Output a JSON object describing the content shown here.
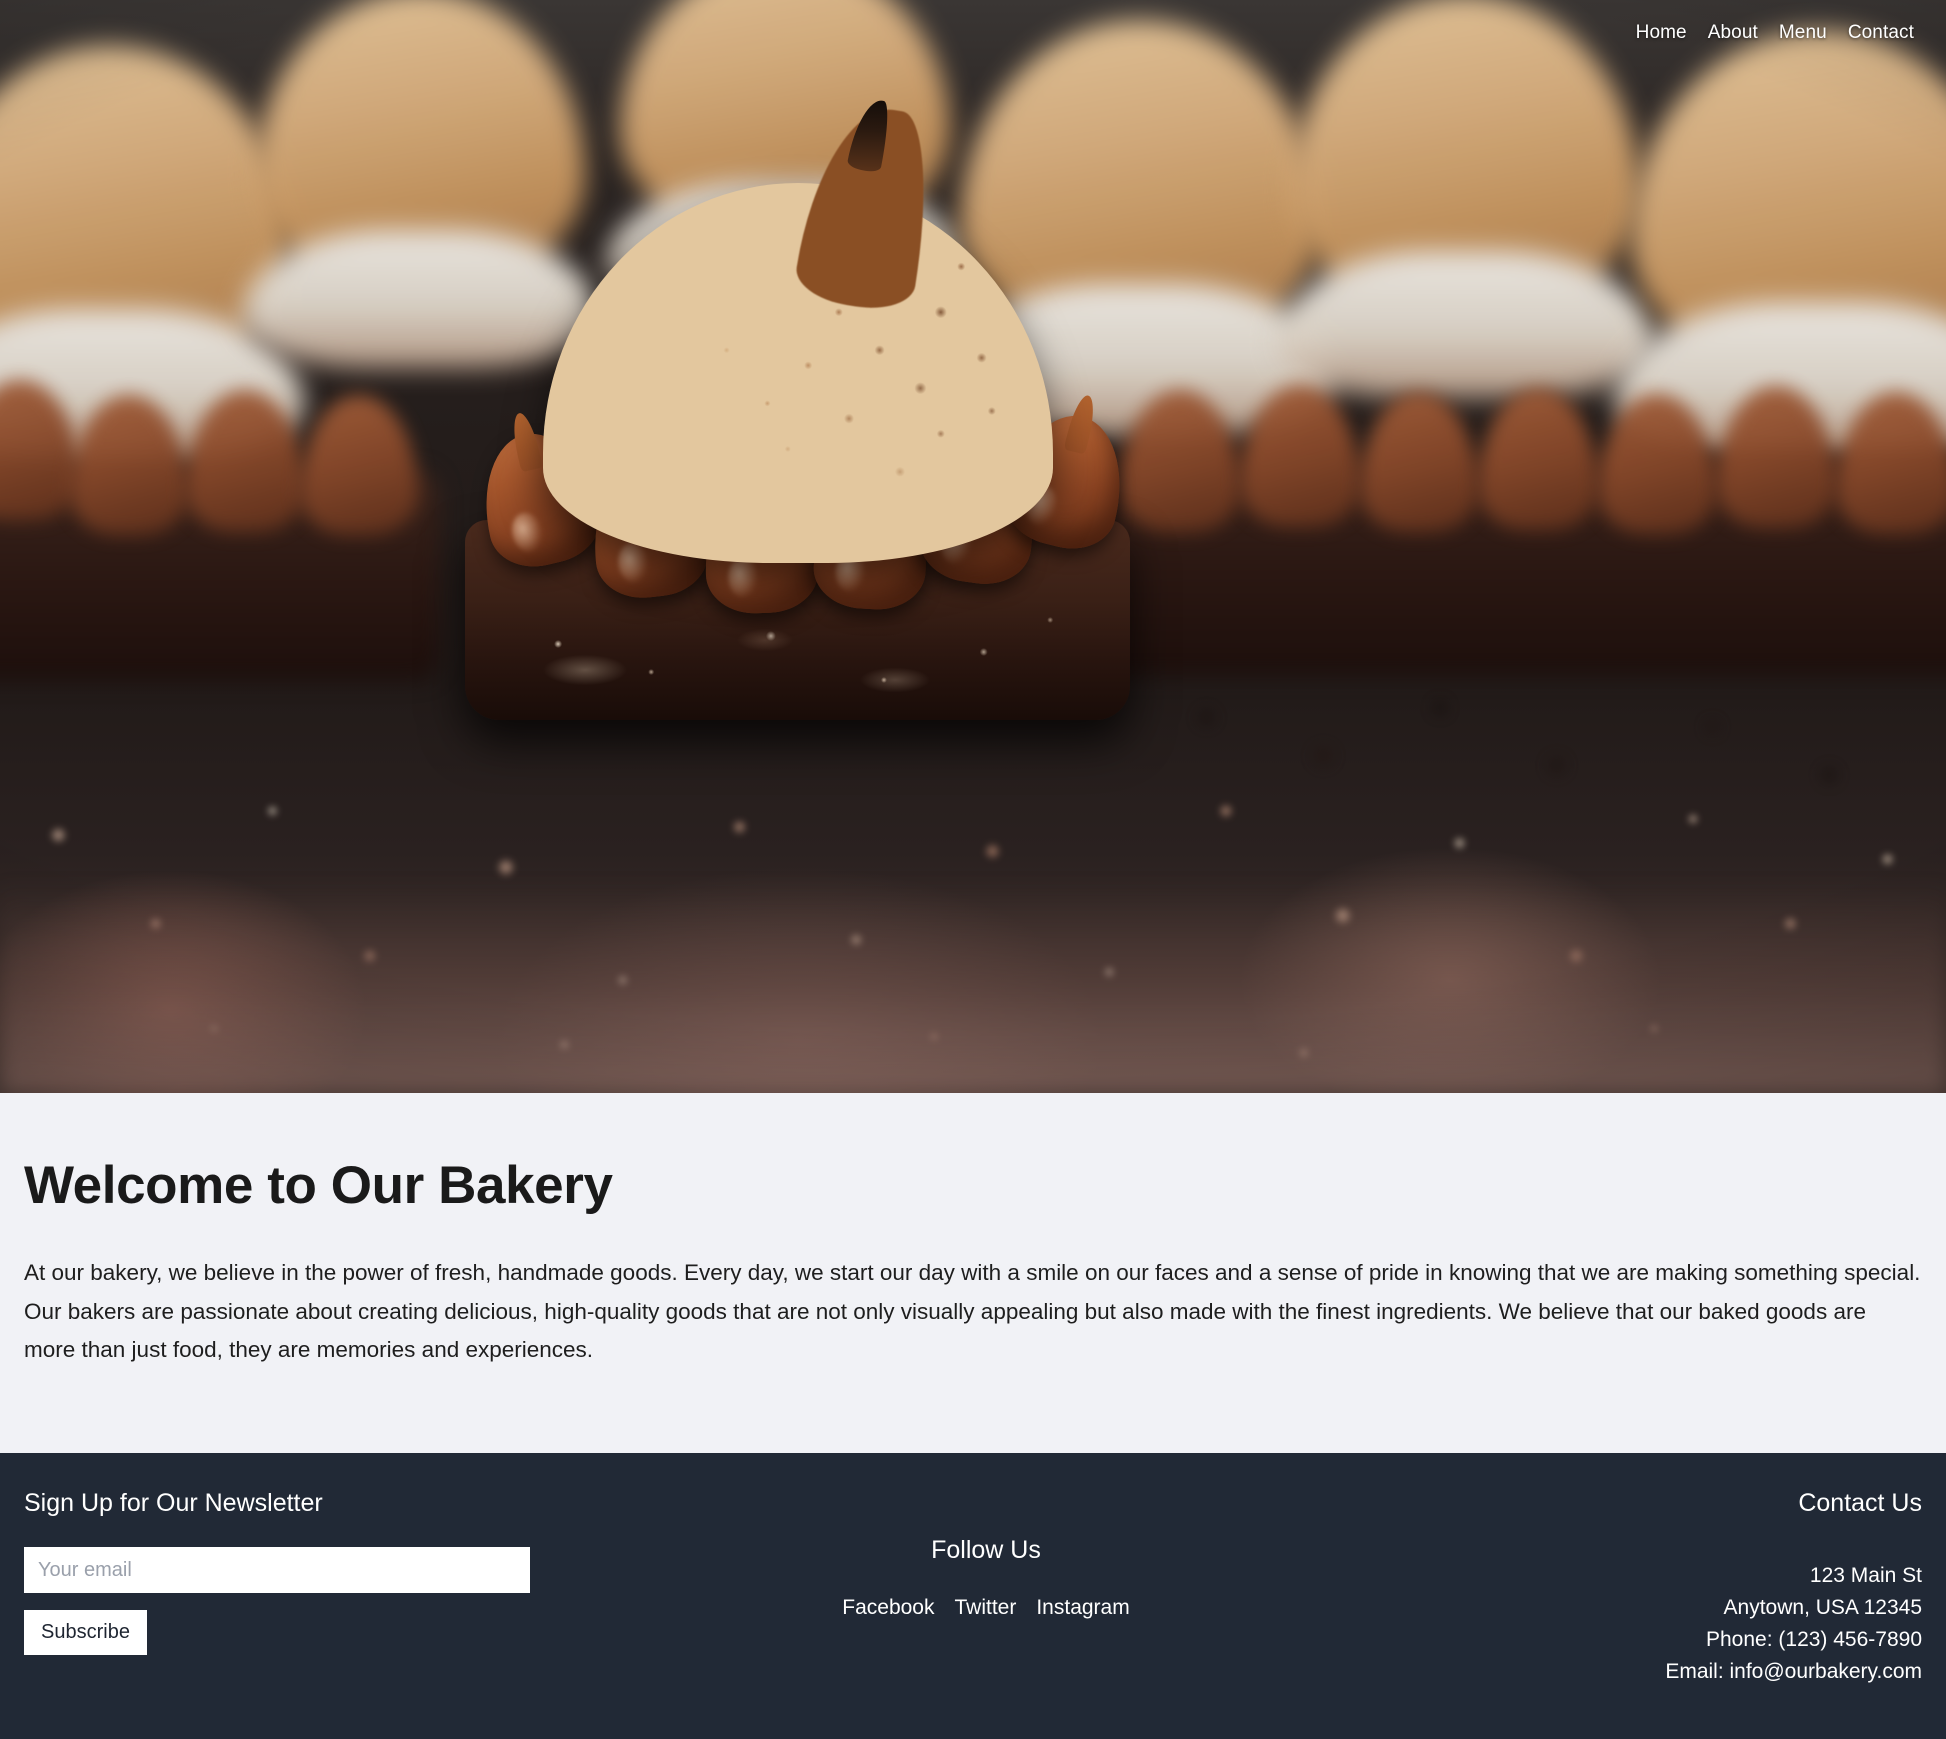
{
  "nav": {
    "items": [
      {
        "label": "Home"
      },
      {
        "label": "About"
      },
      {
        "label": "Menu"
      },
      {
        "label": "Contact"
      }
    ]
  },
  "hero": {
    "image_alt": "Toasted meringue dessert with chocolate kisses on a brownie base"
  },
  "main": {
    "heading": "Welcome to Our Bakery",
    "paragraph": "At our bakery, we believe in the power of fresh, handmade goods. Every day, we start our day with a smile on our faces and a sense of pride in knowing that we are making something special. Our bakers are passionate about creating delicious, high-quality goods that are not only visually appealing but also made with the finest ingredients. We believe that our baked goods are more than just food, they are memories and experiences."
  },
  "footer": {
    "newsletter": {
      "heading": "Sign Up for Our Newsletter",
      "email_placeholder": "Your email",
      "email_value": "",
      "subscribe_label": "Subscribe"
    },
    "follow": {
      "heading": "Follow Us",
      "links": [
        {
          "label": "Facebook"
        },
        {
          "label": "Twitter"
        },
        {
          "label": "Instagram"
        }
      ]
    },
    "contact": {
      "heading": "Contact Us",
      "lines": [
        "123 Main St",
        "Anytown, USA 12345",
        "Phone: (123) 456-7890",
        "Email: info@ourbakery.com"
      ]
    }
  },
  "colors": {
    "page_bg": "#f1f2f6",
    "footer_bg": "#212936",
    "text_dark": "#1a1a1a",
    "text_light": "#ffffff",
    "button_bg": "#ffffff"
  }
}
